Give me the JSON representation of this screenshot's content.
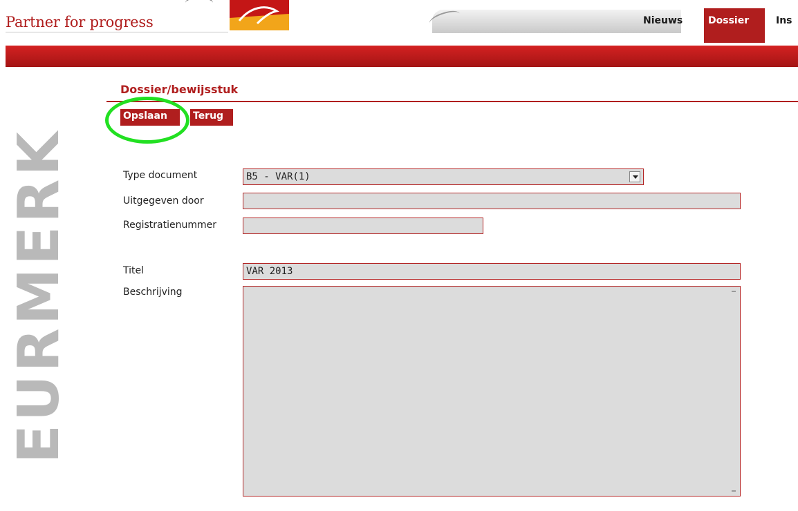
{
  "header": {
    "tagline": "Partner for progress",
    "nav": {
      "news": "Nieuws",
      "dossier": "Dossier",
      "more": "Ins"
    }
  },
  "sidebar": {
    "brand": "EURMERK"
  },
  "page": {
    "title": "Dossier/bewijsstuk"
  },
  "toolbar": {
    "save_label": "Opslaan",
    "back_label": "Terug"
  },
  "form": {
    "type_document_label": "Type document",
    "type_document_value": "B5 - VAR(1)",
    "issued_by_label": "Uitgegeven door",
    "issued_by_value": "",
    "registration_label": "Registratienummer",
    "registration_value": "",
    "title_label": "Titel",
    "title_value": "VAR 2013",
    "description_label": "Beschrijving",
    "description_value": ""
  },
  "colors": {
    "brand_red": "#b01e1e",
    "highlight_green": "#22e022",
    "field_bg": "#dcdcdc"
  }
}
